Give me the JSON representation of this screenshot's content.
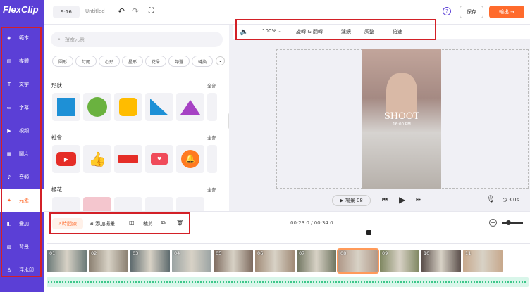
{
  "app": {
    "name": "FlexClip"
  },
  "topbar": {
    "ratio": "9:16",
    "title": "Untitled",
    "save_label": "保存",
    "export_label": "輸出 →"
  },
  "sidebar": {
    "items": [
      {
        "label": "範本",
        "icon": "template-icon"
      },
      {
        "label": "媒體",
        "icon": "media-folder-icon"
      },
      {
        "label": "文字",
        "icon": "text-icon"
      },
      {
        "label": "字幕",
        "icon": "subtitle-icon"
      },
      {
        "label": "視頻",
        "icon": "video-icon"
      },
      {
        "label": "圖片",
        "icon": "image-icon"
      },
      {
        "label": "音頻",
        "icon": "music-icon"
      },
      {
        "label": "元素",
        "icon": "elements-icon"
      },
      {
        "label": "疊加",
        "icon": "overlay-icon"
      },
      {
        "label": "背景",
        "icon": "background-icon"
      },
      {
        "label": "浮水印",
        "icon": "watermark-icon"
      }
    ],
    "active": 7
  },
  "panel": {
    "search_placeholder": "搜索元素",
    "chips": [
      "圓形",
      "訂閱",
      "心形",
      "星形",
      "花朵",
      "勾選",
      "轉換"
    ],
    "sections": [
      {
        "title": "形狀",
        "more": "全部"
      },
      {
        "title": "社會",
        "more": "全部"
      },
      {
        "title": "櫻花",
        "more": "全部"
      }
    ]
  },
  "canvas_toolbar": {
    "zoom": "100%",
    "items": [
      "旋轉 & 翻轉",
      "濾鏡",
      "調整",
      "倍速"
    ]
  },
  "preview": {
    "headline": "SHOOT",
    "subline": "16:00 PM",
    "scene_label": "場景 08",
    "duration": "3.0s"
  },
  "timeline_toolbar": {
    "items": [
      "時間線",
      "添加場景",
      "",
      "裁剪",
      "",
      ""
    ],
    "time_current": "00:23.0",
    "time_total": "00:34.0",
    "time_sep": "/"
  },
  "clips": [
    "01",
    "02",
    "03",
    "04",
    "05",
    "06",
    "07",
    "08",
    "09",
    "10",
    "11"
  ],
  "colors": {
    "brand": "#5b3fd6",
    "accent": "#ff6b2c",
    "highlight": "#d32027"
  }
}
